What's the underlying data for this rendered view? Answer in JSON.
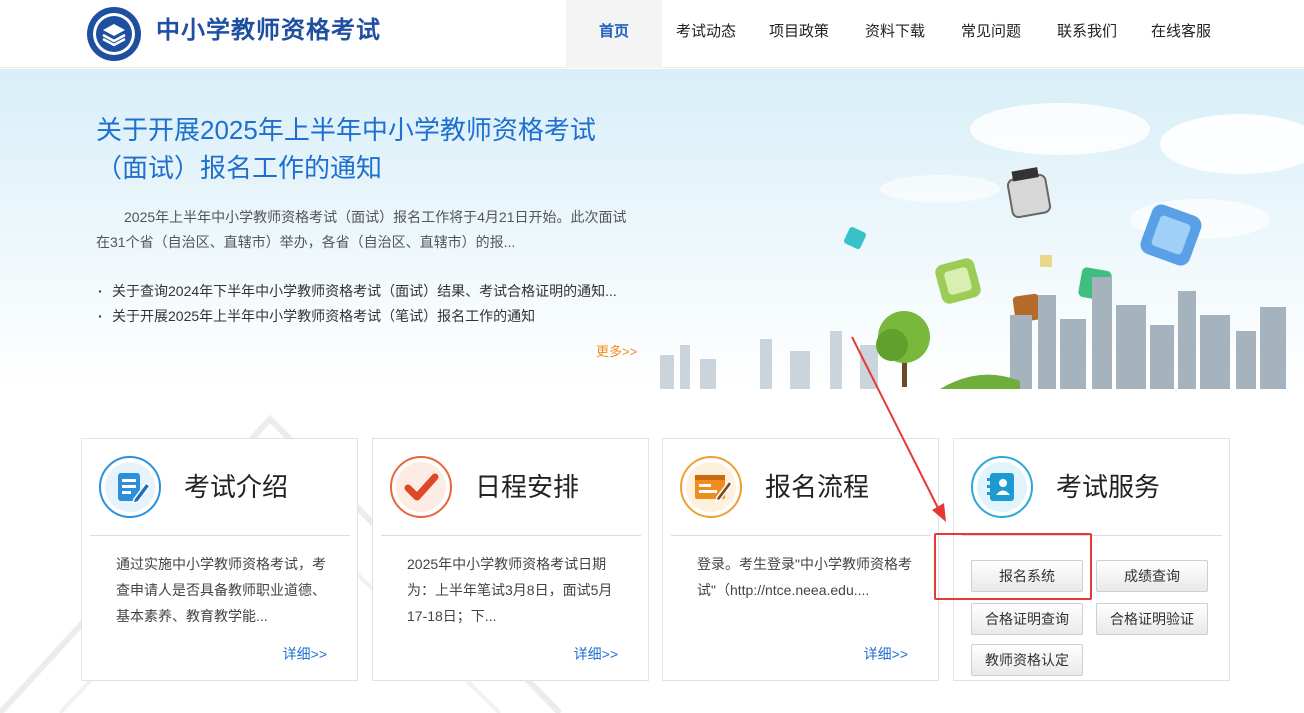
{
  "header": {
    "site_title": "中小学教师资格考试",
    "nav": [
      {
        "label": "首页",
        "active": true
      },
      {
        "label": "考试动态",
        "active": false
      },
      {
        "label": "项目政策",
        "active": false
      },
      {
        "label": "资料下载",
        "active": false
      },
      {
        "label": "常见问题",
        "active": false
      },
      {
        "label": "联系我们",
        "active": false
      },
      {
        "label": "在线客服",
        "active": false
      }
    ]
  },
  "banner": {
    "headline": "关于开展2025年上半年中小学教师资格考试（面试）报名工作的通知",
    "summary": "2025年上半年中小学教师资格考试（面试）报名工作将于4月21日开始。此次面试在31个省（自治区、直辖市）举办，各省（自治区、直辖市）的报...",
    "news": [
      "关于查询2024年下半年中小学教师资格考试（面试）结果、考试合格证明的通知...",
      "关于开展2025年上半年中小学教师资格考试（笔试）报名工作的通知"
    ],
    "more_label": "更多>>"
  },
  "cards": [
    {
      "title": "考试介绍",
      "icon": "edit-document-icon",
      "text": "通过实施中小学教师资格考试，考查申请人是否具备教师职业道德、基本素养、教育教学能...",
      "more_label": "详细>>"
    },
    {
      "title": "日程安排",
      "icon": "checkmark-icon",
      "text": "2025年中小学教师资格考试日期为：上半年笔试3月8日，面试5月17-18日；下...",
      "more_label": "详细>>"
    },
    {
      "title": "报名流程",
      "icon": "form-pencil-icon",
      "text": "登录。考生登录\"中小学教师资格考试\"（http://ntce.neea.edu....",
      "more_label": "详细>>"
    },
    {
      "title": "考试服务",
      "icon": "contacts-book-icon"
    }
  ],
  "services": [
    {
      "label": "报名系统"
    },
    {
      "label": "成绩查询"
    },
    {
      "label": "合格证明查询"
    },
    {
      "label": "合格证明验证"
    },
    {
      "label": "教师资格认定"
    }
  ],
  "colors": {
    "brand_blue": "#1f4fa0",
    "link_blue": "#1f6fd0",
    "more_orange": "#f08c1e",
    "annotation_red": "#e53935"
  }
}
